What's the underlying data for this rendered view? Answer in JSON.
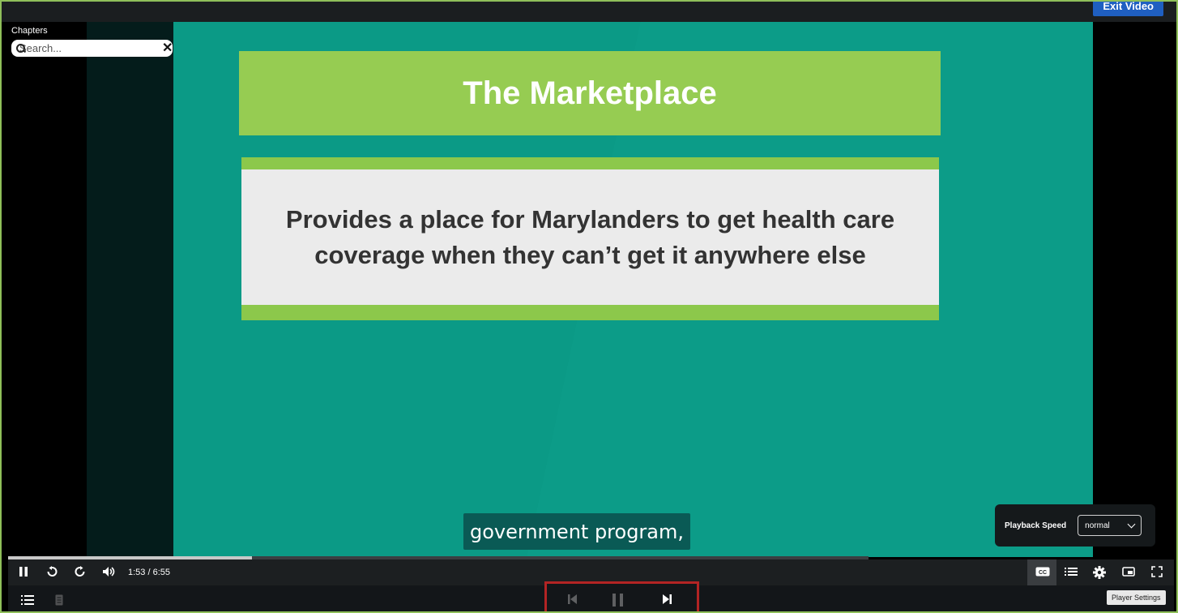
{
  "header": {
    "exit_label": "Exit Video"
  },
  "chapters": {
    "title": "Chapters",
    "search_placeholder": "Search..."
  },
  "slide": {
    "title": "The Marketplace",
    "body": "Provides a place for Marylanders to get health care coverage when they can’t get it anywhere else"
  },
  "caption": "government program,",
  "player": {
    "time": "1:53 / 6:55",
    "progress_fraction": 0.283,
    "speed_label": "Playback Speed",
    "speed_value": "normal",
    "tooltip": "Player Settings"
  }
}
